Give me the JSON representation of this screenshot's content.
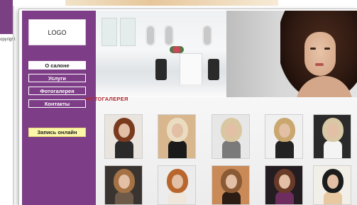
{
  "background": {
    "copyright_text": "opyright"
  },
  "sidebar": {
    "logo": "LOGO",
    "nav": [
      {
        "label": "О салоне",
        "active": true
      },
      {
        "label": "Услуги",
        "active": false
      },
      {
        "label": "Фотогалерея",
        "active": false
      },
      {
        "label": "Контакты",
        "active": false
      }
    ],
    "cta_label": "Запись онлайн"
  },
  "gallery": {
    "title": "ФОТОГАЛЕРЕЯ",
    "photos": [
      {
        "name": "photo-1",
        "bg": "#e9e4de",
        "hair": "#7a3a1e",
        "body": "#2a2a2a"
      },
      {
        "name": "photo-2",
        "bg": "#d8b78e",
        "hair": "#eadcc0",
        "body": "#1a1a1a"
      },
      {
        "name": "photo-3",
        "bg": "#e7e7e7",
        "hair": "#d9c7a1",
        "body": "#7a7a7a"
      },
      {
        "name": "photo-4",
        "bg": "#f0f0f0",
        "hair": "#c9a76e",
        "body": "#222222"
      },
      {
        "name": "photo-5",
        "bg": "#2a2a2a",
        "hair": "#d8c8a6",
        "body": "#f4f4f4"
      },
      {
        "name": "photo-6",
        "bg": "#3a3430",
        "hair": "#a47244",
        "body": "#6e5a48"
      },
      {
        "name": "photo-7",
        "bg": "#ececec",
        "hair": "#b8662c",
        "body": "#efe6dc"
      },
      {
        "name": "photo-8",
        "bg": "#c98a57",
        "hair": "#8a5a34",
        "body": "#2b1c14"
      },
      {
        "name": "photo-9",
        "bg": "#231c20",
        "hair": "#6a3a28",
        "body": "#6d2d5e"
      },
      {
        "name": "photo-10",
        "bg": "#f2efe8",
        "hair": "#1c1c1c",
        "body": "#e7c8a0"
      }
    ]
  },
  "colors": {
    "sidebar": "#7e3e87",
    "accent_title": "#b3262c",
    "cta_bg": "#fbf6a8"
  }
}
